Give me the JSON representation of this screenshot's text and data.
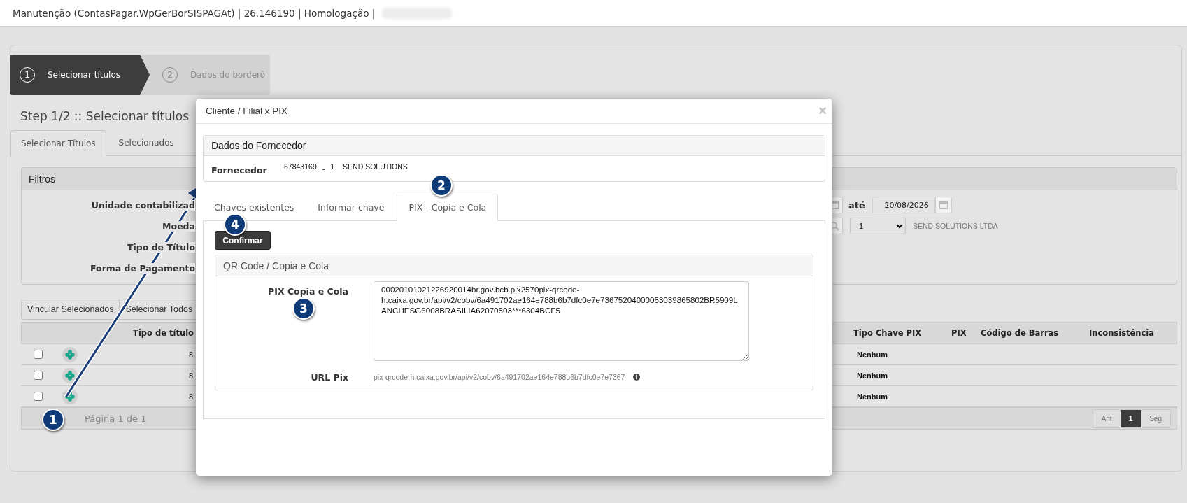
{
  "title_bar": {
    "text": "Manutenção (ContasPagar.WpGerBorSISPAGAt) | 26.146190 | Homologação |"
  },
  "wizard": [
    {
      "number": "1",
      "label": "Selecionar títulos",
      "selected": true
    },
    {
      "number": "2",
      "label": "Dados do borderô",
      "selected": false
    }
  ],
  "step_title": "Step 1/2 :: Selecionar títulos",
  "tabs": [
    {
      "label": "Selecionar Títulos",
      "selected": true
    },
    {
      "label": "Selecionados",
      "selected": false
    }
  ],
  "filters": {
    "title": "Filtros",
    "labels": [
      "Unidade contabilizad",
      "Moeda",
      "Tipo de Título",
      "Forma de Pagamento"
    ],
    "until_label": "até",
    "date_to": "20/08/2026",
    "branch_select": "1",
    "supplier_name": "SEND SOLUTIONS LTDA"
  },
  "actions": [
    "Vincular Selecionados",
    "Selecionar Todos"
  ],
  "table": {
    "columns": [
      "Tipo de título",
      "Tipo Chave PIX",
      "PIX",
      "Código de Barras",
      "Inconsistência"
    ],
    "rows": [
      {
        "checked": false,
        "tipo_de_titulo": "8",
        "tipo_chave_pix": "Nenhum"
      },
      {
        "checked": false,
        "tipo_de_titulo": "8",
        "tipo_chave_pix": "Nenhum"
      },
      {
        "checked": false,
        "tipo_de_titulo": "8",
        "tipo_chave_pix": "Nenhum"
      }
    ]
  },
  "pager": {
    "text": "Página 1 de 1",
    "buttons": [
      {
        "label": "Ant",
        "selected": false
      },
      {
        "label": "1",
        "selected": true
      },
      {
        "label": "Seg",
        "selected": false
      }
    ]
  },
  "modal": {
    "title": "Cliente / Filial x PIX",
    "close": "×",
    "supplier_panel": {
      "title": "Dados do Fornecedor",
      "label": "Fornecedor",
      "code": "67843169",
      "separator": "-",
      "branch": "1",
      "name": "SEND SOLUTIONS"
    },
    "tabs": [
      {
        "label": "Chaves existentes",
        "selected": false
      },
      {
        "label": "Informar chave",
        "selected": false
      },
      {
        "label": "PIX - Copia e Cola",
        "selected": true
      }
    ],
    "confirm_button": "Confirmar",
    "qr_panel": {
      "title": "QR Code / Copia e Cola",
      "pix_label": "PIX Copia e Cola",
      "pix_value": "00020101021226920014br.gov.bcb.pix2570pix-qrcode-h.caixa.gov.br/api/v2/cobv/6a491702ae164e788b6b7dfc0e7e73675204000053039865802BR5909LANCHESG6008BRASILIA62070503***6304BCF5",
      "url_label": "URL Pix",
      "url_value": "pix-qrcode-h.caixa.gov.br/api/v2/cobv/6a491702ae164e788b6b7dfc0e7e7367"
    }
  },
  "callouts": [
    {
      "number": "1"
    },
    {
      "number": "2"
    },
    {
      "number": "3"
    },
    {
      "number": "4"
    }
  ]
}
